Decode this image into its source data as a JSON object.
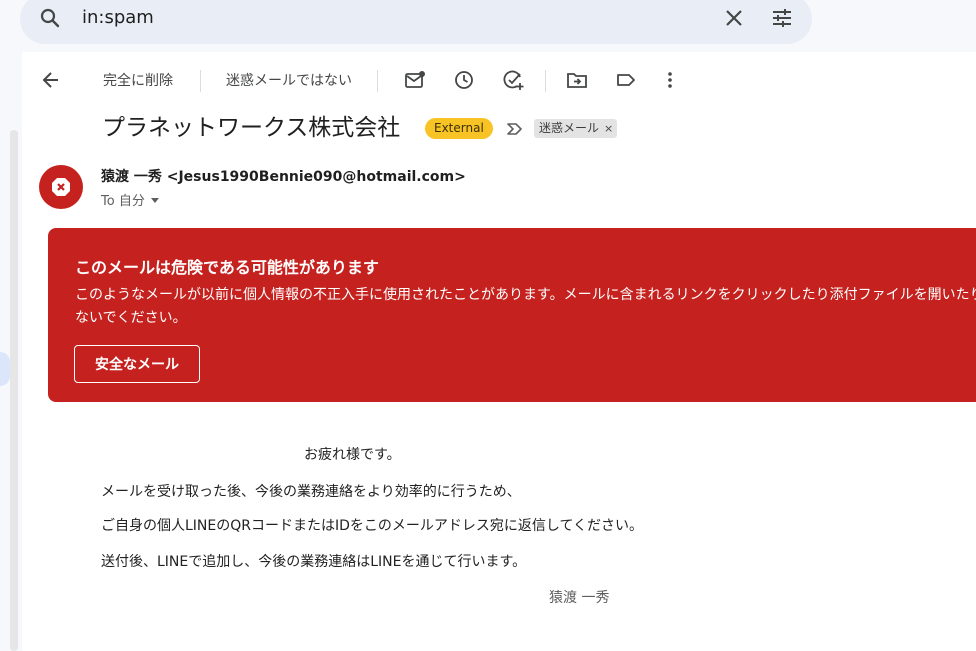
{
  "search": {
    "query": "in:spam"
  },
  "toolbar": {
    "delete_forever": "完全に削除",
    "not_spam": "迷惑メールではない"
  },
  "message": {
    "subject": "プラネットワークス株式会社",
    "external_badge": "External",
    "label_chip": "迷惑メール",
    "label_remove": "×",
    "sender": "猿渡 一秀 <Jesus1990Bennie090@hotmail.com>",
    "to": "To 自分"
  },
  "warning": {
    "title": "このメールは危険である可能性があります",
    "body": "このようなメールが以前に個人情報の不正入手に使用されたことがあります。メールに含まれるリンクをクリックしたり添付ファイルを開いたりしないでください。",
    "safe_button": "安全なメール",
    "color": "#c5221f"
  },
  "body": {
    "greeting": "お疲れ様です。",
    "lines": [
      "メールを受け取った後、今後の業務連絡をより効率的に行うため、",
      "ご自身の個人LINEのQRコードまたはIDをこのメールアドレス宛に返信してください。",
      "送付後、LINEで追加し、今後の業務連絡はLINEを通じて行います。"
    ],
    "signature": "猿渡 一秀"
  },
  "icons": [
    "search-icon",
    "clear-search-icon",
    "search-options-icon",
    "back-arrow-icon",
    "mark-unread-icon",
    "snooze-icon",
    "add-task-icon",
    "move-to-icon",
    "label-icon",
    "more-options-icon",
    "label-arrow-icon",
    "danger-icon",
    "dropdown-icon"
  ],
  "colors": {
    "external_badge": "#f7c325",
    "background": "#f6f8fc"
  }
}
